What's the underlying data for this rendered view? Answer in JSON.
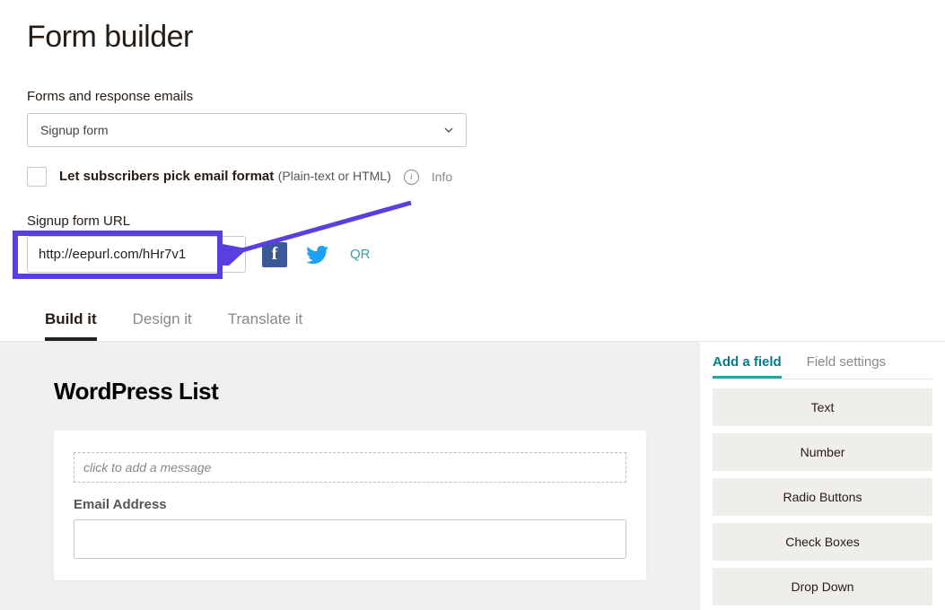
{
  "page": {
    "title": "Form builder"
  },
  "formsSection": {
    "label": "Forms and response emails",
    "select_value": "Signup form"
  },
  "checkbox": {
    "label": "Let subscribers pick email format",
    "suffix": "(Plain-text or HTML)",
    "info_label": "Info"
  },
  "urlSection": {
    "label": "Signup form URL",
    "value": "http://eepurl.com/hHr7v1",
    "qr_label": "QR"
  },
  "tabs": {
    "build": "Build it",
    "design": "Design it",
    "translate": "Translate it"
  },
  "canvas": {
    "title": "WordPress List",
    "message_placeholder": "click to add a message",
    "email_label": "Email Address"
  },
  "sidebar": {
    "tab_add": "Add a field",
    "tab_settings": "Field settings",
    "options": [
      "Text",
      "Number",
      "Radio Buttons",
      "Check Boxes",
      "Drop Down"
    ]
  }
}
